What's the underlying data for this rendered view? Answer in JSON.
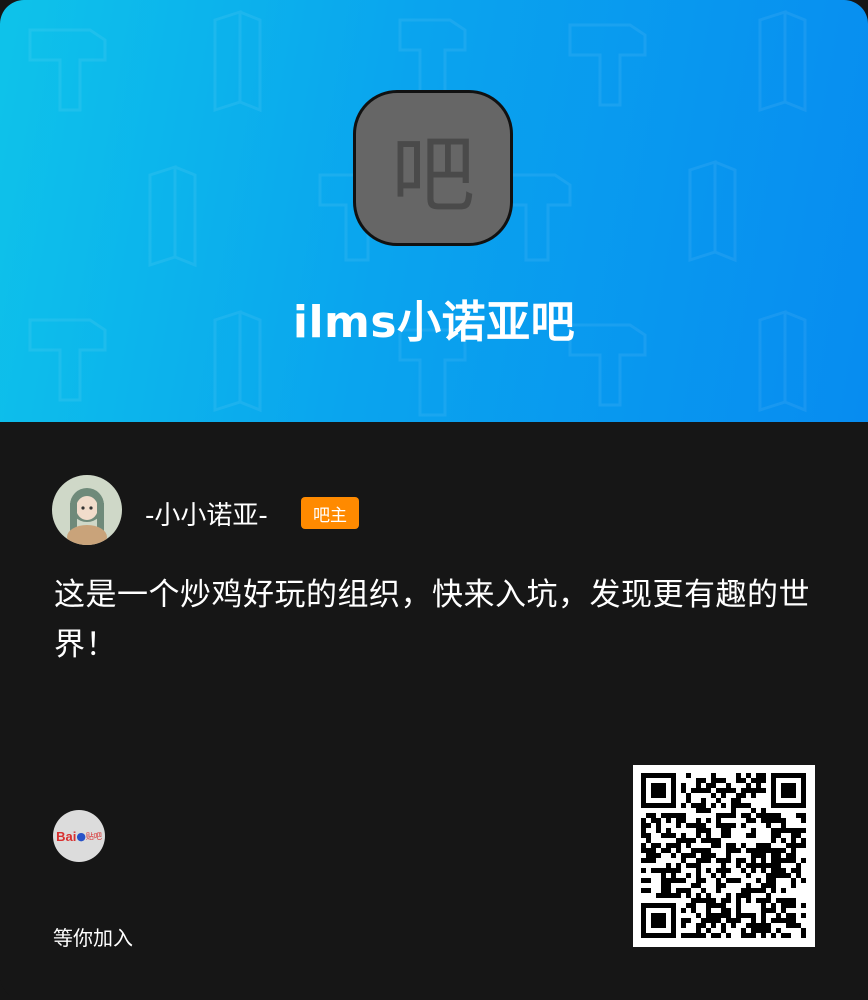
{
  "header": {
    "bar_icon_char": "吧",
    "bar_name": "ilms小诺亚吧",
    "gradient_start": "#0ec3ea",
    "gradient_end": "#078cf0"
  },
  "owner": {
    "username": "-小小诺亚-",
    "badge": "吧主",
    "badge_color": "#ff8a00",
    "avatar_icon": "anime-girl-avatar"
  },
  "description": "这是一个炒鸡好玩的组织，快来入坑，发现更有趣的世界！",
  "footer": {
    "logo_text": "Bai",
    "logo_text_2": "贴吧",
    "logo_icon": "baidu-paw-icon",
    "join_text": "等你加入",
    "qr_icon": "qr-code"
  }
}
